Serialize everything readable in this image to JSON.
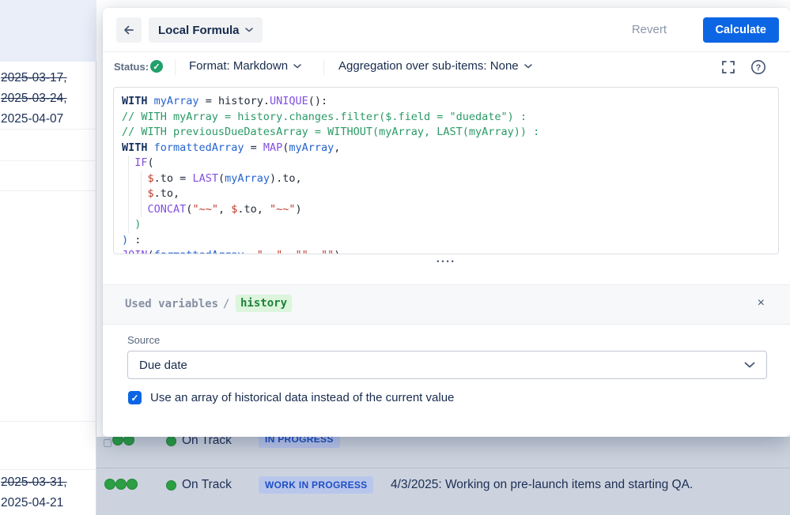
{
  "colors": {
    "accent": "#0c66e4",
    "status_check_green": "#22a06b",
    "dot_green": "#2c9f45",
    "badge_bg": "#b9c6ec",
    "badge_text": "#1d4fc4",
    "row_highlight_bg": "#ccd3de",
    "variable_highlight_bg": "#dcf5dc",
    "variable_highlight_text": "#1e8139"
  },
  "header": {
    "title": "Local Formula",
    "revert_label": "Revert",
    "calculate_label": "Calculate"
  },
  "toolbar": {
    "status_label": "Status:",
    "format_label": "Format: Markdown",
    "aggregation_label": "Aggregation over sub-items: None"
  },
  "editor": {
    "lines": [
      [
        {
          "c": "kw",
          "t": "WITH"
        },
        {
          "c": "pl",
          "t": " "
        },
        {
          "c": "var",
          "t": "myArray"
        },
        {
          "c": "pl",
          "t": " = history."
        },
        {
          "c": "fn",
          "t": "UNIQUE"
        },
        {
          "c": "pl",
          "t": "():"
        }
      ],
      [
        {
          "c": "cm",
          "t": "// WITH myArray = history.changes.filter($.field = \"duedate\") :"
        }
      ],
      [
        {
          "c": "cm",
          "t": "// WITH previousDueDatesArray = WITHOUT(myArray, LAST(myArray)) :"
        }
      ],
      [
        {
          "c": "kw",
          "t": "WITH"
        },
        {
          "c": "pl",
          "t": " "
        },
        {
          "c": "var",
          "t": "formattedArray"
        },
        {
          "c": "pl",
          "t": " = "
        },
        {
          "c": "fn",
          "t": "MAP"
        },
        {
          "c": "pl",
          "t": "("
        },
        {
          "c": "var",
          "t": "myArray"
        },
        {
          "c": "pl",
          "t": ","
        }
      ],
      [
        {
          "c": "pl",
          "t": "  "
        },
        {
          "c": "fn",
          "t": "IF"
        },
        {
          "c": "pl",
          "t": "("
        }
      ],
      [
        {
          "c": "pl",
          "t": "    "
        },
        {
          "c": "str",
          "t": "$"
        },
        {
          "c": "pl",
          "t": ".to = "
        },
        {
          "c": "fn",
          "t": "LAST"
        },
        {
          "c": "pl",
          "t": "("
        },
        {
          "c": "var",
          "t": "myArray"
        },
        {
          "c": "pl",
          "t": ").to,"
        }
      ],
      [
        {
          "c": "pl",
          "t": "    "
        },
        {
          "c": "str",
          "t": "$"
        },
        {
          "c": "pl",
          "t": ".to,"
        }
      ],
      [
        {
          "c": "pl",
          "t": "    "
        },
        {
          "c": "fn",
          "t": "CONCAT"
        },
        {
          "c": "pl",
          "t": "("
        },
        {
          "c": "str",
          "t": "\"~~\""
        },
        {
          "c": "pl",
          "t": ", "
        },
        {
          "c": "str",
          "t": "$"
        },
        {
          "c": "pl",
          "t": ".to, "
        },
        {
          "c": "str",
          "t": "\"~~\""
        },
        {
          "c": "pl",
          "t": ")"
        }
      ],
      [
        {
          "c": "pl",
          "t": "  "
        },
        {
          "c": "pg",
          "t": ")"
        }
      ],
      [
        {
          "c": "pb",
          "t": ")"
        },
        {
          "c": "pl",
          "t": " :"
        }
      ],
      [
        {
          "c": "fn",
          "t": "JOIN"
        },
        {
          "c": "pl",
          "t": "("
        },
        {
          "c": "var",
          "t": "formattedArray"
        },
        {
          "c": "pl",
          "t": ", "
        },
        {
          "c": "str",
          "t": "\", \""
        },
        {
          "c": "pl",
          "t": ", "
        },
        {
          "c": "str",
          "t": "\"\""
        },
        {
          "c": "pl",
          "t": ", "
        },
        {
          "c": "str",
          "t": "\"\""
        },
        {
          "c": "pl",
          "t": ")"
        }
      ]
    ]
  },
  "resize_handle": "••••",
  "used_variables": {
    "title": "Used variables",
    "separator": "/",
    "variable": "history",
    "close_icon": "×"
  },
  "source_panel": {
    "label": "Source",
    "value": "Due date",
    "checkbox_checked": true,
    "checkbox_label": "Use an array of historical data instead of the current value"
  },
  "table": {
    "top_dates": [
      {
        "text": "2025-03-17,",
        "struck": true
      },
      {
        "text": "2025-03-24,",
        "struck": true
      },
      {
        "text": "2025-04-07",
        "struck": false
      }
    ],
    "bottom_dates": [
      {
        "text": "2025-03-31,",
        "struck": true
      },
      {
        "text": "2025-04-21",
        "struck": false
      }
    ],
    "partial_row": {
      "status": "On Track",
      "badge": "IN PROGRESS"
    },
    "last_row": {
      "status": "On Track",
      "badge": "WORK IN PROGRESS",
      "note": "4/3/2025: Working on pre-launch items and starting QA."
    }
  }
}
